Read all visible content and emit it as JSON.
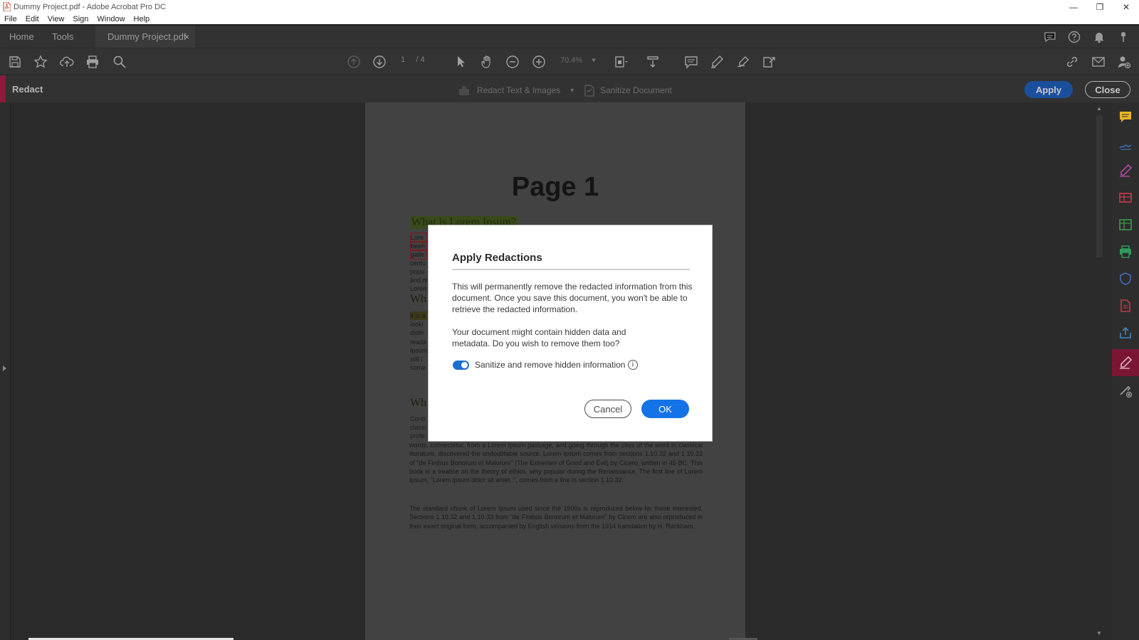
{
  "window": {
    "title": "Dummy Project.pdf - Adobe Acrobat Pro DC",
    "minimize": "—",
    "restore": "❐",
    "close": "✕"
  },
  "menu": [
    "File",
    "Edit",
    "View",
    "Sign",
    "Window",
    "Help"
  ],
  "tabs": {
    "home": "Home",
    "tools": "Tools",
    "document": "Dummy Project.pdf",
    "close_glyph": "×"
  },
  "toolbar": {
    "page_current": "1",
    "page_total": "/ 4",
    "zoom": "70.4%"
  },
  "redact_bar": {
    "label": "Redact",
    "redact_text_images": "Redact Text & Images",
    "sanitize_document": "Sanitize Document",
    "apply": "Apply",
    "close": "Close"
  },
  "document": {
    "page_title": "Page 1",
    "heading1": "What is Lorem Ipsum?",
    "heading2_partial": "Wh",
    "heading3_partial": "Wh",
    "frags1": [
      "Lore",
      "been",
      "galle",
      "centu",
      "popu",
      "and m",
      "Lorem"
    ],
    "frags2": [
      "It is a",
      "looki",
      "distri",
      "reada",
      "Ipsum",
      "still i",
      "some"
    ],
    "frags3": [
      "Contr",
      "classi",
      "profe"
    ],
    "para1": "words, consectetur, from a Lorem Ipsum passage, and going through the cites of the word in classical literature, discovered the undoubtable source. Lorem Ipsum comes from sections 1.10.32 and 1.10.33 of \"de Finibus Bonorum et Malorum\" (The Extremes of Good and Evil) by Cicero, written in 45 BC. This book is a treatise on the theory of ethics, very popular during the Renaissance. The first line of Lorem Ipsum, \"Lorem ipsum dolor sit amet..\", comes from a line in section 1.10.32.",
    "para2": "The standard chunk of Lorem Ipsum used since the 1500s is reproduced below for those interested. Sections 1.10.32 and 1.10.33 from \"de Finibus Bonorum et Malorum\" by Cicero are also reproduced in their exact original form, accompanied by English versions from the 1914 translation by H. Rackham."
  },
  "dialog": {
    "title": "Apply Redactions",
    "body1": "This will permanently remove the redacted information from this document. Once you save this document, you won't be able to retrieve the redacted information.",
    "body2": "Your document might contain hidden data and metadata. Do you wish to remove them too?",
    "toggle_label": "Sanitize and remove hidden information",
    "toggle_on": true,
    "info_glyph": "i",
    "cancel": "Cancel",
    "ok": "OK"
  },
  "colors": {
    "accent_blue": "#1473e6",
    "redact_accent": "#8b1a3c"
  }
}
